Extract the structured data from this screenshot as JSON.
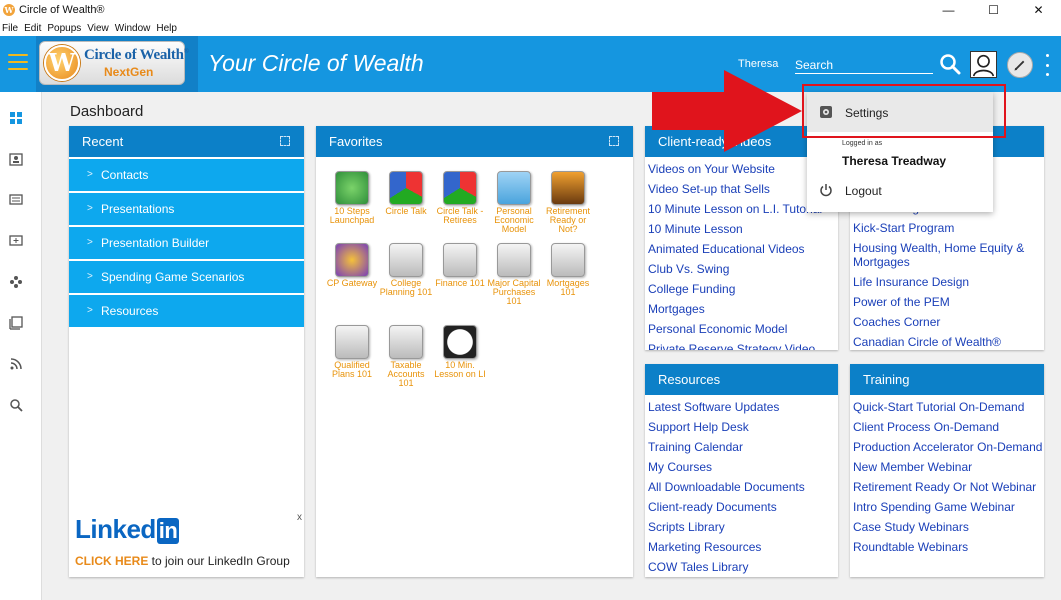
{
  "window": {
    "title": "Circle of Wealth®",
    "controls": [
      "—",
      "☐",
      "✕"
    ]
  },
  "menu": [
    "File",
    "Edit",
    "Popups",
    "View",
    "Window",
    "Help"
  ],
  "header": {
    "logo_main": "Circle of Wealth",
    "logo_reg": "®",
    "logo_sub": "NextGen",
    "logo_letter": "W",
    "app_title": "Your Circle of Wealth",
    "username": "Theresa",
    "search_placeholder": "Search",
    "accent": "#1596e0"
  },
  "dashboard": {
    "title": "Dashboard"
  },
  "recent": {
    "title": "Recent",
    "items": [
      "Contacts",
      "Presentations",
      "Presentation Builder",
      "Spending Game Scenarios",
      "Resources"
    ],
    "linkedin": {
      "logo": "Linked",
      "logo_in": "in",
      "close": "x",
      "cta_bold": "CLICK HERE",
      "cta_rest": " to join our LinkedIn Group"
    }
  },
  "favorites": {
    "title": "Favorites",
    "items": [
      {
        "label": "10 Steps Launchpad",
        "icon": "launchpad-icon"
      },
      {
        "label": "Circle Talk",
        "icon": "circle-talk-icon"
      },
      {
        "label": "Circle Talk - Retirees",
        "icon": "circle-talk-retirees-icon"
      },
      {
        "label": "Personal Economic Model",
        "icon": "pem-icon"
      },
      {
        "label": "Retirement Ready or Not?",
        "icon": "retirement-icon"
      },
      {
        "label": "CP Gateway",
        "icon": "cp-gateway-icon"
      },
      {
        "label": "College Planning 101",
        "icon": "presenter-icon"
      },
      {
        "label": "Finance 101",
        "icon": "presenter-icon"
      },
      {
        "label": "Major Capital Purchases 101",
        "icon": "presenter-icon"
      },
      {
        "label": "Mortgages 101",
        "icon": "presenter-icon"
      },
      {
        "label": "Qualified Plans 101",
        "icon": "presenter-icon"
      },
      {
        "label": "Taxable Accounts 101",
        "icon": "presenter-icon"
      },
      {
        "label": "10 Min. Lesson on LI",
        "icon": "clock-icon"
      }
    ]
  },
  "client_videos": {
    "title": "Client-ready Videos",
    "links": [
      "Videos on Your Website",
      "Video Set-up that Sells",
      "10 Minute Lesson on L.I. Tutorial",
      "10 Minute Lesson",
      "Animated Educational Videos",
      "Club Vs. Swing",
      "College Funding",
      "Mortgages",
      "Personal Economic Model",
      "Private Reserve Strategy Video"
    ]
  },
  "programs": {
    "links": [
      "Mentor Program",
      "Kick-Start Program",
      "Housing Wealth, Home Equity & Mortgages",
      "Life Insurance Design",
      "Power of the PEM",
      "Coaches Corner",
      "Canadian Circle of Wealth®"
    ]
  },
  "resources": {
    "title": "Resources",
    "links": [
      "Latest Software Updates",
      "Support Help Desk",
      "Training Calendar",
      "My Courses",
      "All Downloadable Documents",
      "Client-ready Documents",
      "Scripts Library",
      "Marketing Resources",
      "COW Tales Library"
    ]
  },
  "training": {
    "title": "Training",
    "links": [
      "Quick-Start Tutorial On-Demand",
      "Client Process On-Demand",
      "Production Accelerator On-Demand",
      "New Member Webinar",
      "Retirement Ready Or Not Webinar",
      "Intro Spending Game Webinar",
      "Case Study Webinars",
      "Roundtable Webinars"
    ]
  },
  "dropdown": {
    "settings": "Settings",
    "logged_in_as": "Logged in as",
    "user_full": "Theresa Treadway",
    "logout": "Logout"
  },
  "colors": {
    "panel_head": "#0c80c8",
    "recent_item": "#0da8ee",
    "link": "#1a3fb8",
    "fav_label": "#e8930a",
    "highlight": "#e0141c"
  }
}
